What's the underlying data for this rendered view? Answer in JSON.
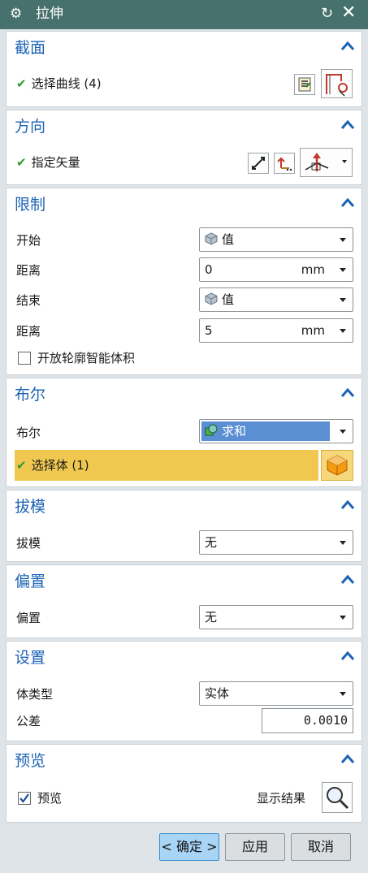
{
  "window": {
    "title": "拉伸"
  },
  "sections": {
    "section": {
      "title": "截面",
      "select_label": "选择曲线 (4)"
    },
    "direction": {
      "title": "方向",
      "vector_label": "指定矢量"
    },
    "limits": {
      "title": "限制",
      "start_label": "开始",
      "start_value": "值",
      "dist1_label": "距离",
      "dist1_value": "0",
      "dist1_unit": "mm",
      "end_label": "结束",
      "end_value": "值",
      "dist2_label": "距离",
      "dist2_value": "5",
      "dist2_unit": "mm",
      "open_profile_label": "开放轮廓智能体积"
    },
    "boolean": {
      "title": "布尔",
      "label": "布尔",
      "value": "求和",
      "select_body_label": "选择体 (1)"
    },
    "draft": {
      "title": "拔模",
      "label": "拔模",
      "value": "无"
    },
    "offset": {
      "title": "偏置",
      "label": "偏置",
      "value": "无"
    },
    "settings": {
      "title": "设置",
      "body_type_label": "体类型",
      "body_type_value": "实体",
      "tolerance_label": "公差",
      "tolerance_value": "0.0010"
    },
    "preview": {
      "title": "预览",
      "preview_label": "预览",
      "show_result_label": "显示结果"
    }
  },
  "buttons": {
    "ok": "< 确定 >",
    "apply": "应用",
    "cancel": "取消"
  },
  "colors": {
    "accent": "#1d63b4",
    "title_bar": "#47716c",
    "highlight_row": "#f0c850",
    "boolean_selected": "#5b8fd4"
  }
}
